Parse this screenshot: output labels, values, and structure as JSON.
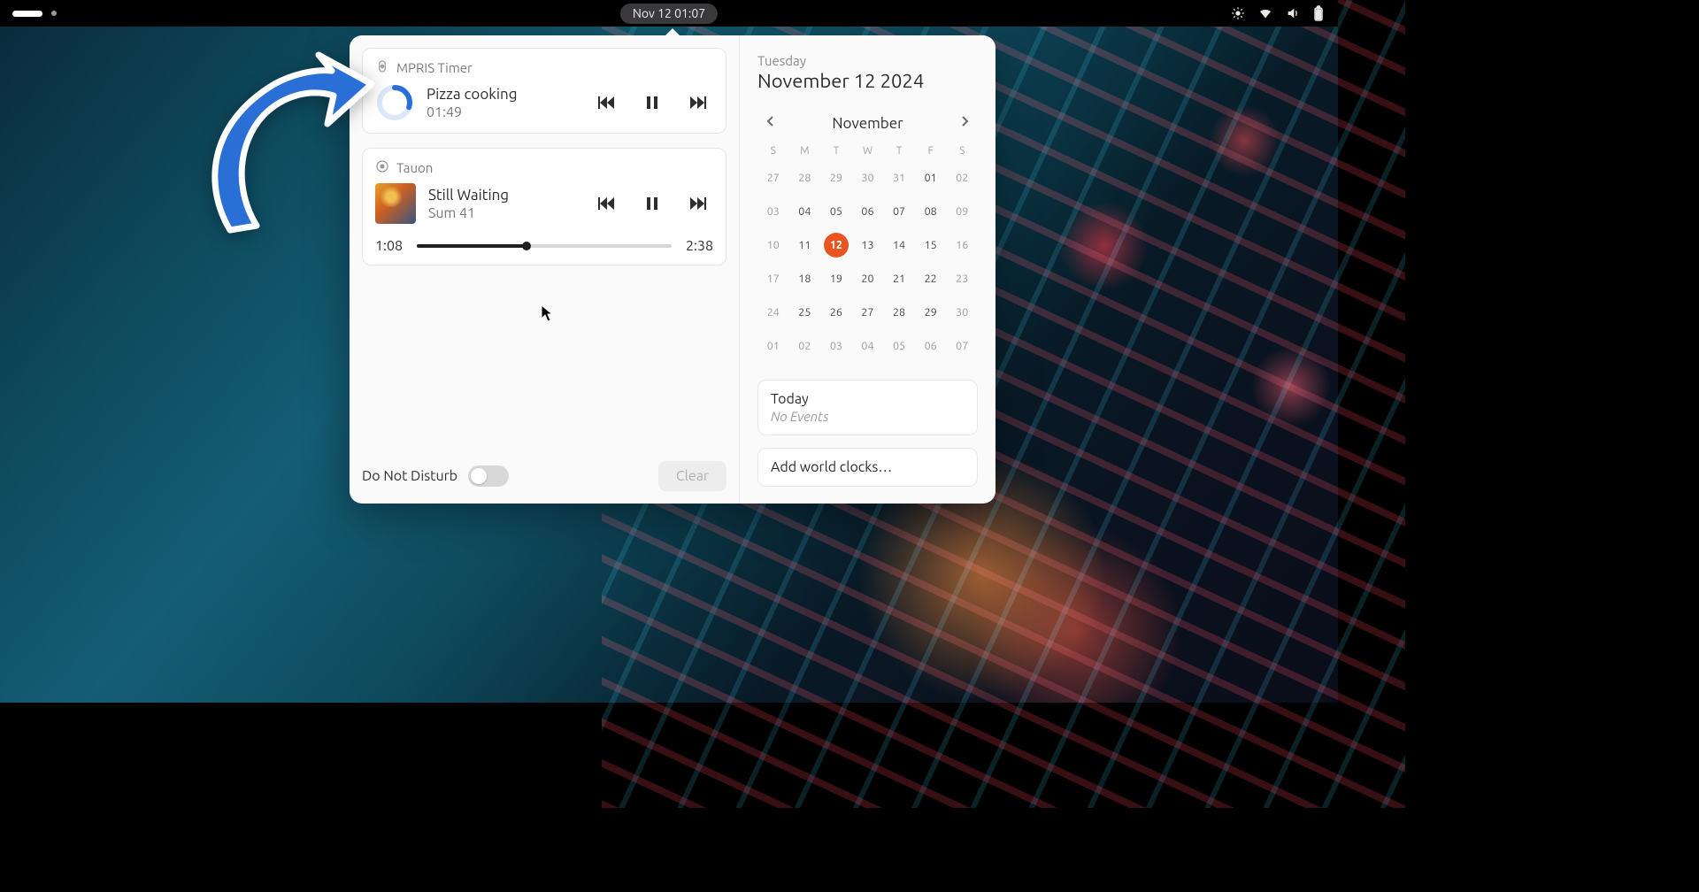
{
  "topbar": {
    "datetime": "Nov 12  01:07"
  },
  "notifications": {
    "timer_card": {
      "app_name": "MPRIS Timer",
      "title": "Pizza cooking",
      "remaining": "01:49",
      "progress_pct": 30
    },
    "music_card": {
      "app_name": "Tauon",
      "title": "Still Waiting",
      "artist": "Sum 41",
      "elapsed": "1:08",
      "duration": "2:38",
      "progress_pct": 43
    },
    "dnd_label": "Do Not Disturb",
    "dnd_enabled": false,
    "clear_label": "Clear"
  },
  "calendar": {
    "weekday": "Tuesday",
    "full_date": "November 12 2024",
    "month_label": "November",
    "dow": [
      "S",
      "M",
      "T",
      "W",
      "T",
      "F",
      "S"
    ],
    "weeks": [
      [
        {
          "d": "27",
          "in": false
        },
        {
          "d": "28",
          "in": false
        },
        {
          "d": "29",
          "in": false
        },
        {
          "d": "30",
          "in": false
        },
        {
          "d": "31",
          "in": false
        },
        {
          "d": "01",
          "in": true
        },
        {
          "d": "02",
          "in": false
        }
      ],
      [
        {
          "d": "03",
          "in": false
        },
        {
          "d": "04",
          "in": true
        },
        {
          "d": "05",
          "in": true
        },
        {
          "d": "06",
          "in": true
        },
        {
          "d": "07",
          "in": true
        },
        {
          "d": "08",
          "in": true
        },
        {
          "d": "09",
          "in": false
        }
      ],
      [
        {
          "d": "10",
          "in": false
        },
        {
          "d": "11",
          "in": true
        },
        {
          "d": "12",
          "in": true,
          "today": true
        },
        {
          "d": "13",
          "in": true
        },
        {
          "d": "14",
          "in": true
        },
        {
          "d": "15",
          "in": true
        },
        {
          "d": "16",
          "in": false
        }
      ],
      [
        {
          "d": "17",
          "in": false
        },
        {
          "d": "18",
          "in": true
        },
        {
          "d": "19",
          "in": true
        },
        {
          "d": "20",
          "in": true
        },
        {
          "d": "21",
          "in": true
        },
        {
          "d": "22",
          "in": true
        },
        {
          "d": "23",
          "in": false
        }
      ],
      [
        {
          "d": "24",
          "in": false
        },
        {
          "d": "25",
          "in": true
        },
        {
          "d": "26",
          "in": true
        },
        {
          "d": "27",
          "in": true
        },
        {
          "d": "28",
          "in": true
        },
        {
          "d": "29",
          "in": true
        },
        {
          "d": "30",
          "in": false
        }
      ],
      [
        {
          "d": "01",
          "in": false
        },
        {
          "d": "02",
          "in": false
        },
        {
          "d": "03",
          "in": false
        },
        {
          "d": "04",
          "in": false
        },
        {
          "d": "05",
          "in": false
        },
        {
          "d": "06",
          "in": false
        },
        {
          "d": "07",
          "in": false
        }
      ]
    ],
    "events": {
      "title": "Today",
      "empty_text": "No Events"
    },
    "world_clocks_label": "Add world clocks…"
  },
  "colors": {
    "accent": "#e95420",
    "ring": "#2a6fd6"
  }
}
